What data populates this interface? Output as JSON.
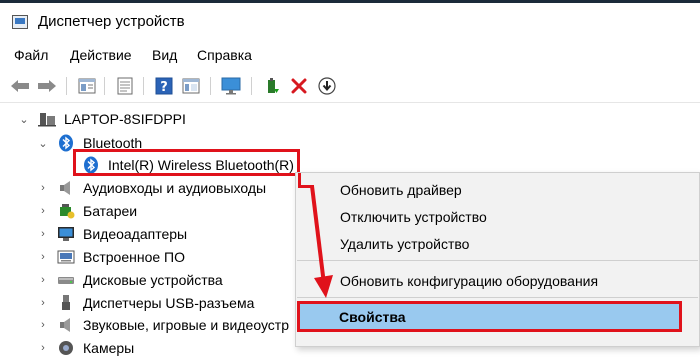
{
  "window": {
    "title": "Диспетчер устройств"
  },
  "menu": [
    "Файл",
    "Действие",
    "Вид",
    "Справка"
  ],
  "toolbar": {
    "buttons": [
      "back-icon",
      "forward-icon",
      "properties-icon",
      "update-icon",
      "help-icon",
      "view-icon",
      "monitor-icon",
      "add-driver-icon",
      "uninstall-icon",
      "download-icon"
    ]
  },
  "tree": {
    "root": "LAPTOP-8SIFDPPI",
    "bluetooth": {
      "label": "Bluetooth",
      "child": "Intel(R) Wireless Bluetooth(R)"
    },
    "categories": [
      "Аудиовходы и аудиовыходы",
      "Батареи",
      "Видеоадаптеры",
      "Встроенное ПО",
      "Дисковые устройства",
      "Диспетчеры USB-разъема",
      "Звуковые, игровые и видеоустр",
      "Камеры"
    ]
  },
  "context_menu": {
    "items": [
      "Обновить драйвер",
      "Отключить устройство",
      "Удалить устройство"
    ],
    "scan": "Обновить конфигурацию оборудования",
    "properties": "Свойства"
  },
  "colors": {
    "highlight": "#e0121b",
    "selection": "#99c9ef",
    "bluetooth": "#1e6fd0"
  }
}
